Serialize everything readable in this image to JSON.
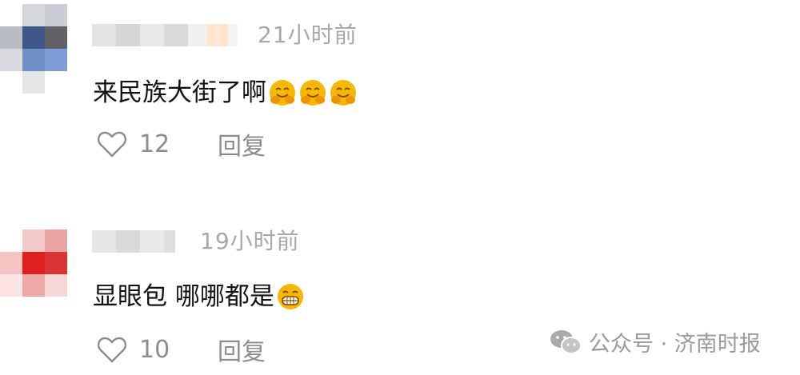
{
  "comments": [
    {
      "time": "21小时前",
      "text": "来民族大街了啊",
      "emoji": "hugging-face-icon",
      "emoji_count": 3,
      "likes": "12",
      "reply_label": "回复"
    },
    {
      "time": "19小时前",
      "text": "显眼包 哪哪都是",
      "emoji": "grinning-face-icon",
      "emoji_count": 1,
      "likes": "10",
      "reply_label": "回复"
    }
  ],
  "watermark": {
    "label": "公众号 · 济南时报",
    "icon": "wechat-icon"
  },
  "colors": {
    "text": "#111111",
    "meta": "#a8a8a8",
    "action": "#8c8c8c",
    "emoji": "#f5b800"
  }
}
